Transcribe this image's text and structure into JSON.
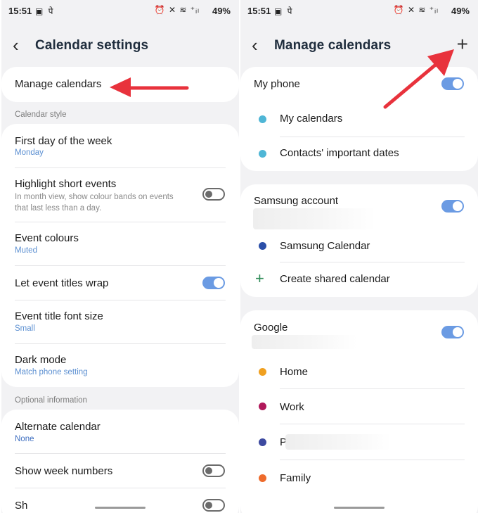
{
  "status": {
    "time": "15:51",
    "left_icons": "▣ पे",
    "right_icons": "⏰ ✕ ≋ ⁺ᵢₗ",
    "battery": "49%"
  },
  "left_screen": {
    "title": "Calendar settings",
    "manage_calendars": "Manage calendars",
    "section_calendar_style": "Calendar style",
    "first_day": {
      "label": "First day of the week",
      "value": "Monday"
    },
    "highlight": {
      "label": "Highlight short events",
      "desc": "In month view, show colour bands on events that last less than a day.",
      "on": false
    },
    "event_colours": {
      "label": "Event colours",
      "value": "Muted"
    },
    "wrap_titles": {
      "label": "Let event titles wrap",
      "on": true
    },
    "font_size": {
      "label": "Event title font size",
      "value": "Small"
    },
    "dark_mode": {
      "label": "Dark mode",
      "value": "Match phone setting"
    },
    "section_optional": "Optional information",
    "alternate_calendar": {
      "label": "Alternate calendar",
      "value": "None"
    },
    "week_numbers": {
      "label": "Show week numbers",
      "on": false
    },
    "partial_row": "Sh"
  },
  "right_screen": {
    "title": "Manage calendars",
    "my_phone": {
      "label": "My phone",
      "on": true
    },
    "my_calendars": "My calendars",
    "contacts_dates": "Contacts' important dates",
    "samsung_account": {
      "label": "Samsung account",
      "on": true
    },
    "samsung_calendar": "Samsung Calendar",
    "create_shared": "Create shared calendar",
    "google": {
      "label": "Google",
      "on": true
    },
    "home": "Home",
    "work": "Work",
    "partial_calendar": "P",
    "family": "Family"
  },
  "colors": {
    "accent_blue": "#6b9be3",
    "value_blue": "#5b8fd1",
    "arrow_red": "#e8323c",
    "dot_teal": "#4fb6d6",
    "dot_navy": "#2b4fa8",
    "dot_orange": "#f0a020",
    "dot_magenta": "#b0185a",
    "dot_indigo": "#3d4aa0",
    "dot_red_orange": "#ee6b2c",
    "plus_green": "#2e8b57"
  }
}
